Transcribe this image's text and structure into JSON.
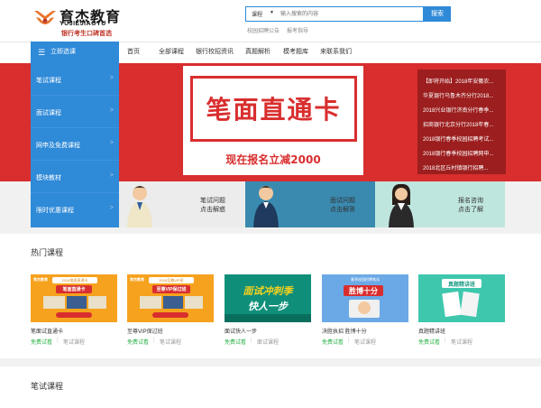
{
  "header": {
    "logo_cn": "育杰教育",
    "logo_en": "YUJIEJIAOYU",
    "slogan": "银行考生口碑首选",
    "search": {
      "category": "课程",
      "placeholder": "输入搜索的内容",
      "button": "搜索",
      "links": [
        "校园招聘公告",
        "报考指导"
      ]
    }
  },
  "nav": {
    "category_header": "立即选课",
    "items": [
      "首页",
      "全部课程",
      "银行校招资讯",
      "真题解析",
      "模考题库",
      "来联系我们"
    ]
  },
  "sidebar": {
    "items": [
      "笔试课程",
      "面试课程",
      "网申及免费课程",
      "模块教材",
      "限时优惠课程"
    ]
  },
  "banner": {
    "title": "笔面直通卡",
    "subtitle": "现在报名立减2000",
    "news": [
      "【即将开始】2018年安徽农...",
      "华夏银行乌鲁木齐分行2018...",
      "2018兴业银行济南分行春季...",
      "招商银行北京分行2018年春...",
      "2018银行春季校园招聘考试...",
      "2018银行春季校园招聘网申...",
      "2018北区丘村镇银行招聘..."
    ]
  },
  "advisory": [
    {
      "line1": "笔试问题",
      "line2": "点击解惑"
    },
    {
      "line1": "面试问题",
      "line2": "点击解答"
    },
    {
      "line1": "报名咨询",
      "line2": "点击了解"
    }
  ],
  "hot": {
    "title": "热门课程",
    "courses": [
      {
        "name": "笔面试直通卡",
        "free": "免费试看",
        "category": "笔试课程",
        "thumb_a": "2018笔面直通卡",
        "thumb_b": "笔面直通卡"
      },
      {
        "name": "至尊VIP保过班",
        "free": "免费试看",
        "category": "笔试课程",
        "thumb_a": "2018至尊VIP班",
        "thumb_b": "至尊VIP保过班"
      },
      {
        "name": "面试快人一步",
        "free": "免费试看",
        "category": "面试课程",
        "thumb_a": "面试冲刺季",
        "thumb_b": "快人一步"
      },
      {
        "name": "决胜执招 胜博十分",
        "free": "免费试看",
        "category": "笔试课程",
        "thumb_a": "春季校园招聘笔试",
        "thumb_b": "胜博十分"
      },
      {
        "name": "真题精讲班",
        "free": "免费试看",
        "category": "笔试课程",
        "thumb_a": "真题精讲班",
        "thumb_b": ""
      }
    ]
  },
  "written": {
    "title": "笔试课程"
  },
  "colors": {
    "primary_blue": "#2f8ad8",
    "banner_red": "#d92e2e",
    "news_dark_red": "#9c1e1e",
    "free_green": "#2db34a"
  }
}
